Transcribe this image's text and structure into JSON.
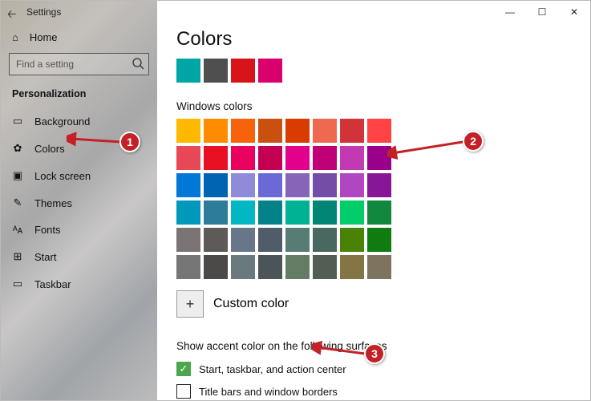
{
  "window": {
    "title": "Settings",
    "minimize": "—",
    "maximize": "☐",
    "close": "✕"
  },
  "sidebar": {
    "home_label": "Home",
    "search_placeholder": "Find a setting",
    "category": "Personalization",
    "items": [
      {
        "icon": "▭",
        "label": "Background"
      },
      {
        "icon": "✿",
        "label": "Colors"
      },
      {
        "icon": "▣",
        "label": "Lock screen"
      },
      {
        "icon": "✎",
        "label": "Themes"
      },
      {
        "icon": "ᴬᴀ",
        "label": "Fonts"
      },
      {
        "icon": "⊞",
        "label": "Start"
      },
      {
        "icon": "▭",
        "label": "Taskbar"
      }
    ]
  },
  "main": {
    "title": "Colors",
    "recent_colors": [
      "#00a6a6",
      "#4f4f4f",
      "#d7141a",
      "#d9006c"
    ],
    "windows_colors_label": "Windows colors",
    "palette": [
      "#ffb900",
      "#ff8c00",
      "#f7630c",
      "#ca5010",
      "#da3b01",
      "#ef6950",
      "#d13438",
      "#ff4343",
      "#e74856",
      "#e81123",
      "#ea005e",
      "#c30052",
      "#e3008c",
      "#bf0077",
      "#c239b3",
      "#9a0089",
      "#0078d7",
      "#0063b1",
      "#8e8cd8",
      "#6b69d6",
      "#8764b8",
      "#744da9",
      "#b146c2",
      "#881798",
      "#0099bc",
      "#2d7d9a",
      "#00b7c3",
      "#038387",
      "#00b294",
      "#018574",
      "#00cc6a",
      "#10893e",
      "#7a7574",
      "#5d5a58",
      "#68768a",
      "#515c6b",
      "#567c73",
      "#486860",
      "#498205",
      "#107c10",
      "#767676",
      "#4c4a48",
      "#69797e",
      "#4a5459",
      "#647c64",
      "#525e54",
      "#847545",
      "#7e735f"
    ],
    "custom_color_label": "Custom color",
    "accent_section": "Show accent color on the following surfaces",
    "chk1_label": "Start, taskbar, and action center",
    "chk1_checked": true,
    "chk2_label": "Title bars and window borders",
    "chk2_checked": false
  },
  "annotations": {
    "badge1": "1",
    "badge2": "2",
    "badge3": "3"
  }
}
